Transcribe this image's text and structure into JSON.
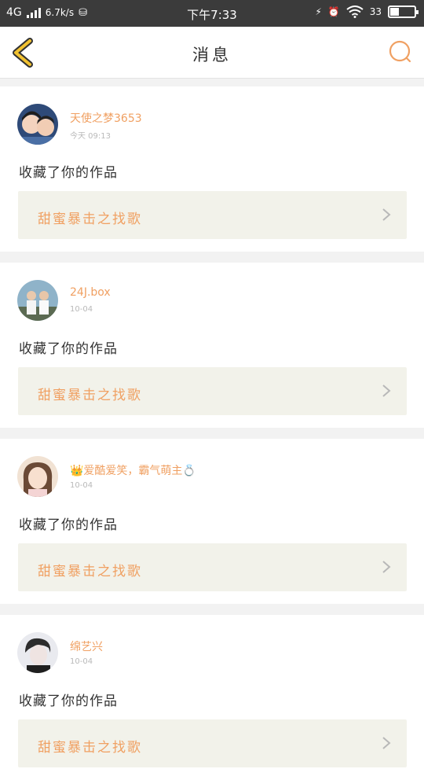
{
  "status_bar": {
    "network": "4G",
    "speed": "6.7k/s",
    "time": "下午7:33",
    "battery": "33",
    "battery_level": 0.33
  },
  "nav": {
    "title": "消息"
  },
  "messages": [
    {
      "username": "天使之梦3653",
      "time": "今天 09:13",
      "action": "收藏了你的作品",
      "work_title": "甜蜜暴击之找歌"
    },
    {
      "username": "24J.box",
      "time": "10-04",
      "action": "收藏了你的作品",
      "work_title": "甜蜜暴击之找歌"
    },
    {
      "username": "👑爱酷爱笑，霸气萌主💍",
      "time": "10-04",
      "action": "收藏了你的作品",
      "work_title": "甜蜜暴击之找歌"
    },
    {
      "username": "绵艺兴",
      "time": "10-04",
      "action": "收藏了你的作品",
      "work_title": "甜蜜暴击之找歌"
    }
  ],
  "colors": {
    "accent": "#f0a062",
    "back_arrow": "#f2c230",
    "card_bg": "#f2f2ea"
  },
  "icons": {
    "back": "chevron-left-icon",
    "search": "search-icon",
    "chevron": "chevron-right-icon"
  }
}
